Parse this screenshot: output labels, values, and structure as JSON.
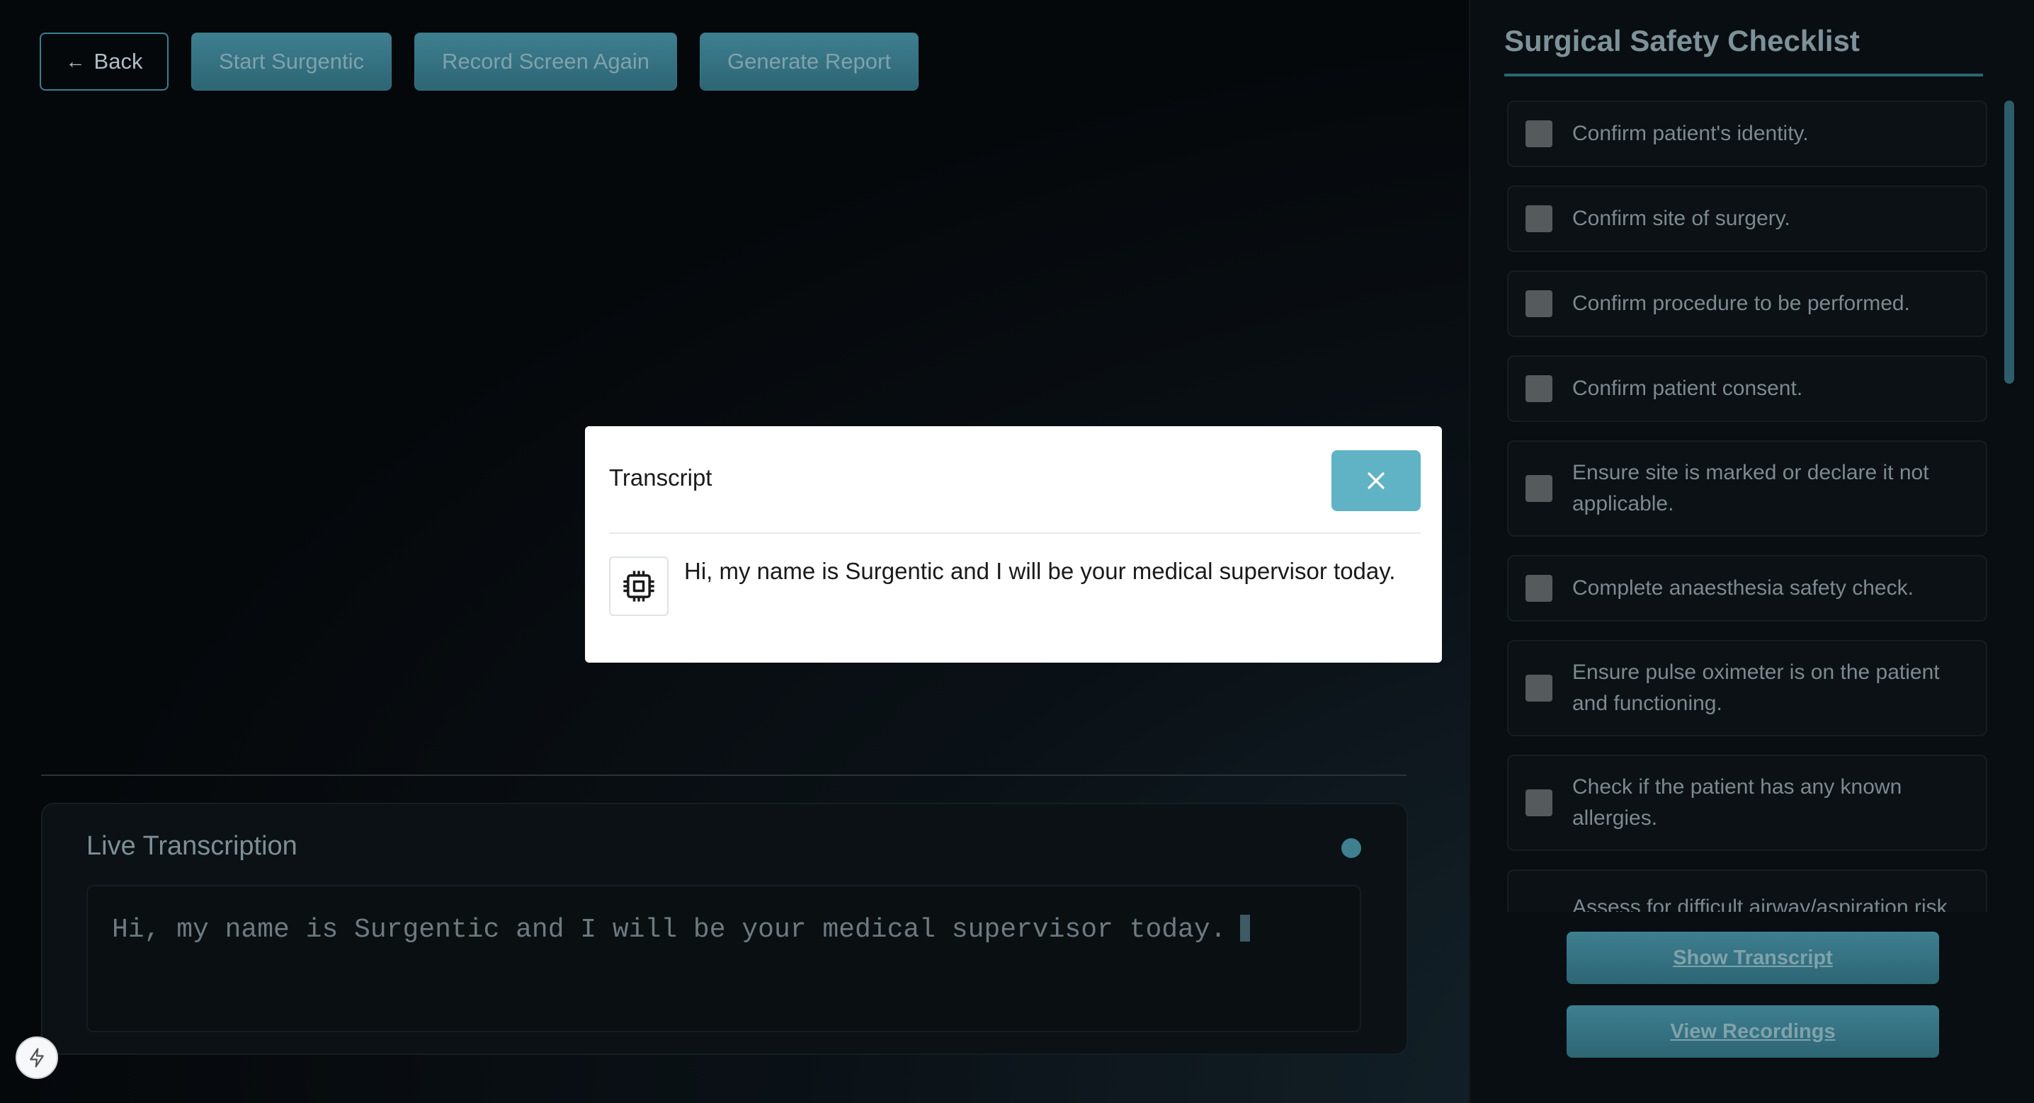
{
  "toolbar": {
    "back_label": "Back",
    "start_label": "Start Surgentic",
    "record_label": "Record Screen Again",
    "report_label": "Generate Report"
  },
  "live": {
    "title": "Live Transcription",
    "text": "Hi, my name is Surgentic and I will be your medical supervisor today."
  },
  "sidebar": {
    "title": "Surgical Safety Checklist",
    "items": [
      {
        "label": "Confirm patient's identity.",
        "checked": false
      },
      {
        "label": "Confirm site of surgery.",
        "checked": false
      },
      {
        "label": "Confirm procedure to be performed.",
        "checked": false
      },
      {
        "label": "Confirm patient consent.",
        "checked": false
      },
      {
        "label": "Ensure site is marked or declare it not applicable.",
        "checked": false
      },
      {
        "label": "Complete anaesthesia safety check.",
        "checked": false
      },
      {
        "label": "Ensure pulse oximeter is on the patient and functioning.",
        "checked": false
      },
      {
        "label": "Check if the patient has any known allergies.",
        "checked": false
      },
      {
        "label": "Assess for difficult airway/aspiration risk",
        "checked": false
      }
    ],
    "show_transcript_label": "Show Transcript",
    "view_recordings_label": "View Recordings"
  },
  "modal": {
    "title": "Transcript",
    "message": "Hi, my name is Surgentic and I will be your medical supervisor today."
  },
  "colors": {
    "accent": "#3e7f90",
    "close_button": "#5fb3c5",
    "background": "#05080b"
  }
}
